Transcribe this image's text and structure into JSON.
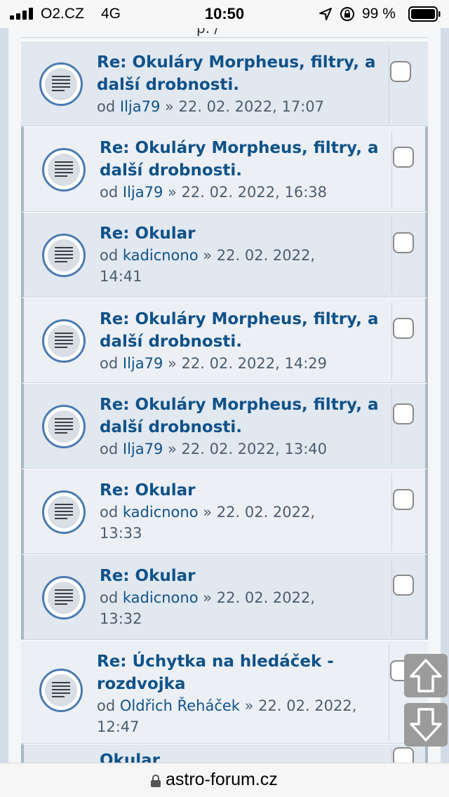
{
  "status_bar": {
    "carrier": "O2.CZ",
    "network": "4G",
    "time": "10:50",
    "battery_percent": "99 %"
  },
  "page_fragment": "p. /",
  "topics": [
    {
      "title_line1": "Re: Okuláry Morpheus, filtry, a",
      "title_line2": "další drobnosti.",
      "meta_prefix": "od",
      "author": "Ilja79",
      "meta_date": "» 22. 02. 2022, 17:07",
      "meta_date2": ""
    },
    {
      "title_line1": "Re: Okuláry Morpheus, filtry, a",
      "title_line2": "další drobnosti.",
      "meta_prefix": "od",
      "author": "Ilja79",
      "meta_date": "» 22. 02. 2022, 16:38",
      "meta_date2": ""
    },
    {
      "title_line1": "Re: Okular",
      "title_line2": "",
      "meta_prefix": "od",
      "author": "kadicnono",
      "meta_date": "» 22. 02. 2022,",
      "meta_date2": "14:41"
    },
    {
      "title_line1": "Re: Okuláry Morpheus, filtry, a",
      "title_line2": "další drobnosti.",
      "meta_prefix": "od",
      "author": "Ilja79",
      "meta_date": "» 22. 02. 2022, 14:29",
      "meta_date2": ""
    },
    {
      "title_line1": "Re: Okuláry Morpheus, filtry, a",
      "title_line2": "další drobnosti.",
      "meta_prefix": "od",
      "author": "Ilja79",
      "meta_date": "» 22. 02. 2022, 13:40",
      "meta_date2": ""
    },
    {
      "title_line1": "Re: Okular",
      "title_line2": "",
      "meta_prefix": "od",
      "author": "kadicnono",
      "meta_date": "» 22. 02. 2022,",
      "meta_date2": "13:33"
    },
    {
      "title_line1": "Re: Okular",
      "title_line2": "",
      "meta_prefix": "od",
      "author": "kadicnono",
      "meta_date": "» 22. 02. 2022,",
      "meta_date2": "13:32"
    },
    {
      "title_line1": "Re: Úchytka na hledáček -",
      "title_line2": "rozdvojka",
      "meta_prefix": "od",
      "author": "Oldřich Řeháček",
      "meta_date": "» 22. 02. 2022,",
      "meta_date2": "12:47"
    }
  ],
  "partial_topic_title": "Okular",
  "url_bar": {
    "url": "astro-forum.cz"
  },
  "colors": {
    "link": "#105289",
    "row_dark": "#e1e8f0",
    "row_light": "#ecf0f5",
    "page_bg": "#d2dde8"
  },
  "icons": {
    "topic": "topic-read-icon",
    "scroll_up": "arrow-up-icon",
    "scroll_down": "arrow-down-icon",
    "lock": "lock-icon"
  }
}
